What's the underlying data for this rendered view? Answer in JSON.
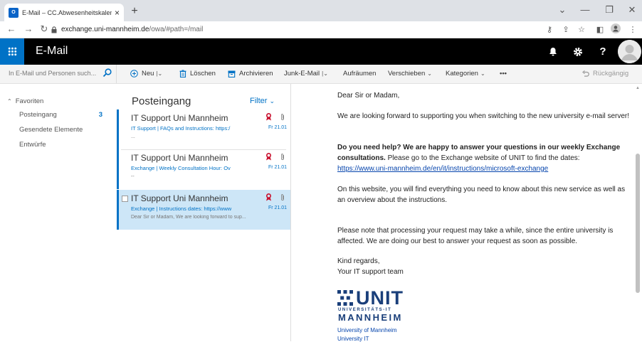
{
  "browser": {
    "tab_title": "E-Mail – CC.Abwesenheitskalender",
    "favicon_text": "O⃞",
    "url_host": "exchange.uni-mannheim.de",
    "url_path": "/owa/#path=/mail"
  },
  "app": {
    "name": "E-Mail"
  },
  "search": {
    "placeholder": "In E-Mail und Personen such..."
  },
  "toolbar": {
    "new_label": "Neu",
    "delete_label": "Löschen",
    "archive_label": "Archivieren",
    "junk_label": "Junk-E-Mail",
    "sweep_label": "Aufräumen",
    "move_label": "Verschieben",
    "categories_label": "Kategorien",
    "more_label": "•••",
    "undo_label": "Rückgängig"
  },
  "folders": {
    "favorites_label": "Favoriten",
    "items": [
      {
        "label": "Posteingang",
        "count": "3"
      },
      {
        "label": "Gesendete Elemente"
      },
      {
        "label": "Entwürfe"
      }
    ]
  },
  "list": {
    "title": "Posteingang",
    "filter_label": "Filter",
    "messages": [
      {
        "from": "IT Support Uni Mannheim",
        "subject": "IT Support | FAQs and Instructions: https:/",
        "date": "Fr 21.01",
        "preview": "..."
      },
      {
        "from": "IT Support Uni Mannheim",
        "subject": "Exchange | Weekly Consultation Hour: Ov",
        "date": "Fr 21.01",
        "preview": "--"
      },
      {
        "from": "IT Support Uni Mannheim",
        "subject": "Exchange | Instructions dates: https://www",
        "date": "Fr 21.01",
        "preview": "Dear Sir or Madam, We are looking forward to sup..."
      }
    ]
  },
  "reading": {
    "greeting": "Dear Sir or Madam,",
    "p1": "We are looking forward to supporting you when switching to the new university e-mail server!",
    "p2_bold": "Do you need help? We are happy to answer your questions in our weekly Exchange consultations.",
    "p2_rest": " Please go to the Exchange website of UNIT to find the dates: ",
    "p2_link": "https://www.uni-mannheim.de/en/it/instructions/microsoft-exchange",
    "p3": "On this website, you will find everything you need to know about this new service as well as an overview about the instructions.",
    "p4": "Please note that processing your request may take a while, since the entire university is affected. We are doing our best to answer your request as soon as possible.",
    "closing1": "Kind regards,",
    "closing2": "Your IT support team",
    "logo_word": "UNIT",
    "logo_sub1": "UNIVERSITÄTS-IT",
    "logo_sub2": "MANNHEIM",
    "sig1": "University of Mannheim",
    "sig2": "University IT"
  },
  "colors": {
    "accent": "#0072c6",
    "topbar": "#000000",
    "selected_row": "#cde6f7",
    "flag": "#c8102e"
  }
}
